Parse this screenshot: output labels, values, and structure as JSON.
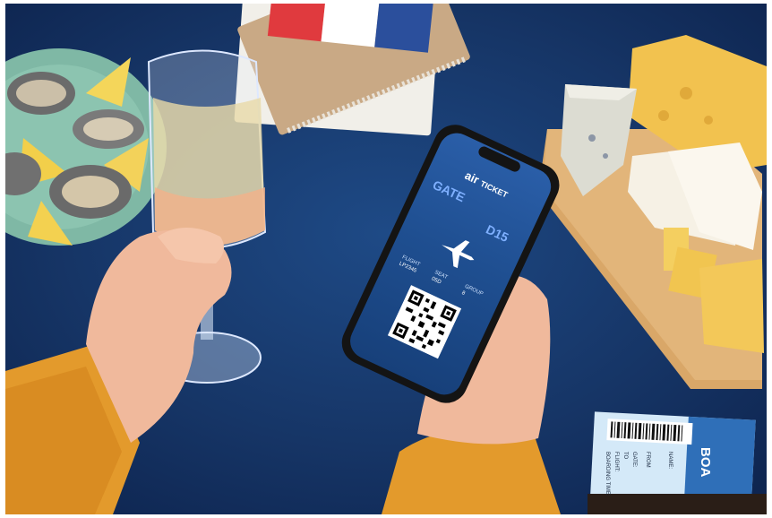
{
  "phone": {
    "brand_top": "air",
    "brand_main": "TICKET",
    "gate_label": "GATE",
    "gate_value": "D15",
    "flight_label": "FLIGHT",
    "flight_value": "LP2345",
    "seat_label": "SEAT",
    "seat_value": "05D",
    "group_label": "GROUP",
    "group_value": "8"
  },
  "ticket_stub": {
    "board_text": "BOA",
    "name_label": "NAME:",
    "from_label": "FROM",
    "gate_label": "GATE:",
    "to_label": "TO",
    "flight_label": "FLIGHT:",
    "boarding_label": "BOARDING TIME:"
  },
  "colors": {
    "tablecloth": "#163566",
    "sweater": "#e39a2c",
    "cheese": "#f2c24f",
    "plate": "#7fb8a5",
    "phone_screen": "#1f4f91",
    "ticket": "#cfe6f7"
  }
}
